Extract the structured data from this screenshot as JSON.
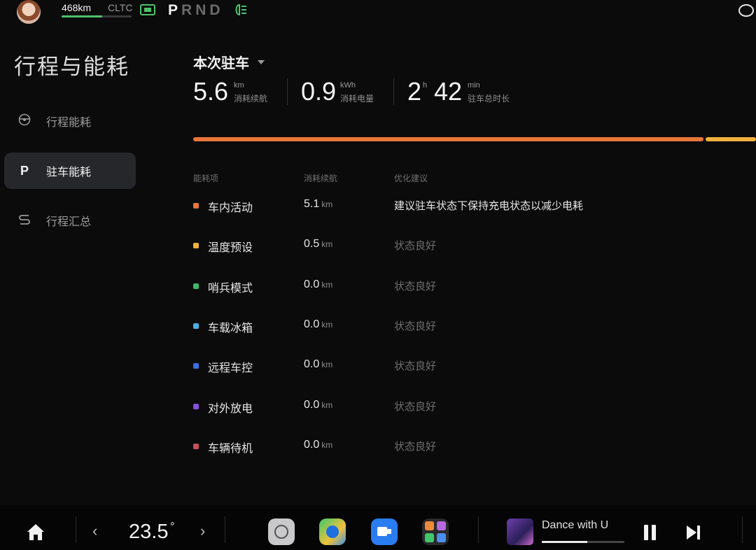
{
  "status": {
    "range": "468km",
    "range_standard": "CLTC",
    "range_level_fraction": 0.58,
    "gears": [
      "P",
      "R",
      "N",
      "D"
    ],
    "active_gear": "P",
    "accent": "#4cc36a"
  },
  "sidebar": {
    "title": "行程与能耗",
    "items": [
      {
        "label": "行程能耗",
        "icon": "steering-wheel-icon"
      },
      {
        "label": "驻车能耗",
        "icon": "parking-icon",
        "glyph": "P",
        "active": true
      },
      {
        "label": "行程汇总",
        "icon": "summary-icon"
      }
    ]
  },
  "main": {
    "selector_label": "本次驻车",
    "stats": [
      {
        "value": "5.6",
        "unit": "km",
        "desc": "消耗续航"
      },
      {
        "value": "0.9",
        "unit": "kWh",
        "desc": "消耗电量"
      },
      {
        "value_h": "2",
        "unit_h": "h",
        "value_m": "42",
        "unit_m": "min",
        "desc": "驻车总时长"
      }
    ],
    "columns": [
      "能耗项",
      "消耗续航",
      "优化建议"
    ],
    "rows": [
      {
        "name": "车内活动",
        "value": "5.1",
        "unit": "km",
        "tip": "建议驻车状态下保持充电状态以减少电耗",
        "color": "#e8763a"
      },
      {
        "name": "温度预设",
        "value": "0.5",
        "unit": "km",
        "tip": "状态良好",
        "color": "#f0b03e"
      },
      {
        "name": "哨兵模式",
        "value": "0.0",
        "unit": "km",
        "tip": "状态良好",
        "color": "#3fb86a"
      },
      {
        "name": "车载冰箱",
        "value": "0.0",
        "unit": "km",
        "tip": "状态良好",
        "color": "#4aaee6"
      },
      {
        "name": "远程车控",
        "value": "0.0",
        "unit": "km",
        "tip": "状态良好",
        "color": "#3b6fe3"
      },
      {
        "name": "对外放电",
        "value": "0.0",
        "unit": "km",
        "tip": "状态良好",
        "color": "#8a4fe0"
      },
      {
        "name": "车辆待机",
        "value": "0.0",
        "unit": "km",
        "tip": "状态良好",
        "color": "#c94f5a"
      }
    ]
  },
  "dock": {
    "temperature": "23.5",
    "temperature_unit": "°",
    "apps": [
      "settings-app-icon",
      "navigation-app-icon",
      "video-app-icon",
      "apps-grid-icon"
    ],
    "song_title": "Dance with U",
    "song_progress_fraction": 0.55
  }
}
